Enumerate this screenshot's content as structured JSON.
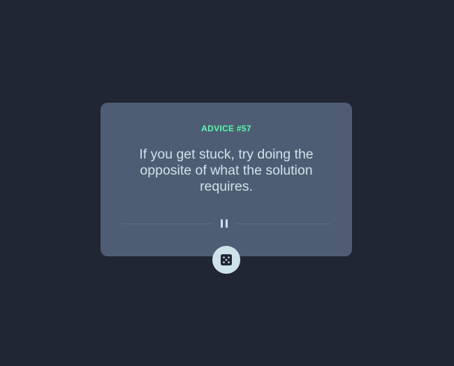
{
  "advice": {
    "id_label": "ADVICE #57",
    "text": "If you get stuck, try doing the opposite of what the solution requires."
  },
  "icons": {
    "divider": "pause-icon",
    "button": "dice-icon"
  },
  "colors": {
    "background": "#202632",
    "card": "#4f5d74",
    "accent": "#53ffaa",
    "text": "#cee3e9",
    "divider_line": "#5f6d84"
  }
}
